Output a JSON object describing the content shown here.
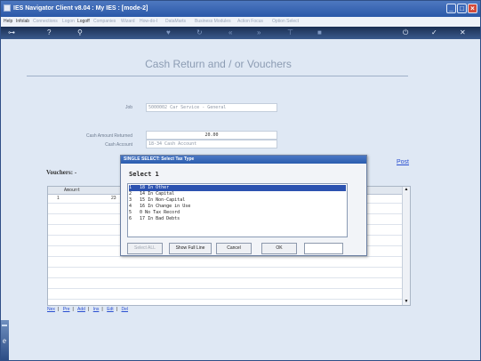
{
  "window": {
    "title": "IES Navigator Client v8.04 : My IES :     [mode-2]"
  },
  "menu": [
    {
      "label": "Help",
      "enabled": true
    },
    {
      "label": "Infolab",
      "enabled": true
    },
    {
      "label": "Connections",
      "enabled": false
    },
    {
      "label": "Logon",
      "enabled": false
    },
    {
      "label": "Logoff",
      "enabled": true
    },
    {
      "label": "Companies",
      "enabled": false
    },
    {
      "label": "Wizard",
      "enabled": false
    },
    {
      "label": "How-do-I",
      "enabled": false
    },
    {
      "label": "DataMarts",
      "enabled": false
    },
    {
      "label": "Business Modules",
      "enabled": false
    },
    {
      "label": "Action Focus",
      "enabled": false
    },
    {
      "label": "Option Select",
      "enabled": false
    }
  ],
  "page": {
    "heading": "Cash Return and / or Vouchers",
    "job_label": "Job",
    "job_value": "5000002 Car Service - General",
    "amount_label": "Cash Amount Returned",
    "amount_value": "20.00",
    "cash_account_label": "Cash Account",
    "cash_account_value": "18-34 Cash Account",
    "vouchers_label": "Vouchers: -",
    "post_link": "Post"
  },
  "grid": {
    "column_header": "Amount",
    "row_number": "1",
    "row_value": "23"
  },
  "grid_nav": [
    "Nex",
    "Pre",
    "Add",
    "Ins",
    "Edt",
    "Del"
  ],
  "modal": {
    "title": "SINGLE SELECT: Select Tax Type",
    "prompt": "Select 1",
    "items": [
      "1   18 In Other",
      "2   14 In Capital",
      "3   15 In Non-Capital",
      "4   16 In Change in Use",
      "5   0 No Tax Record",
      "6   17 In Bad Debts"
    ],
    "selected_index": 0,
    "buttons": {
      "select_all": "Select ALL",
      "show_full_line": "Show Full Line",
      "cancel": "Cancel",
      "ok": "OK"
    }
  },
  "colors": {
    "titlebar": "#2a58a8",
    "selection": "#2c52b0",
    "link": "#2a4fd1",
    "close_button": "#d24a3a"
  }
}
